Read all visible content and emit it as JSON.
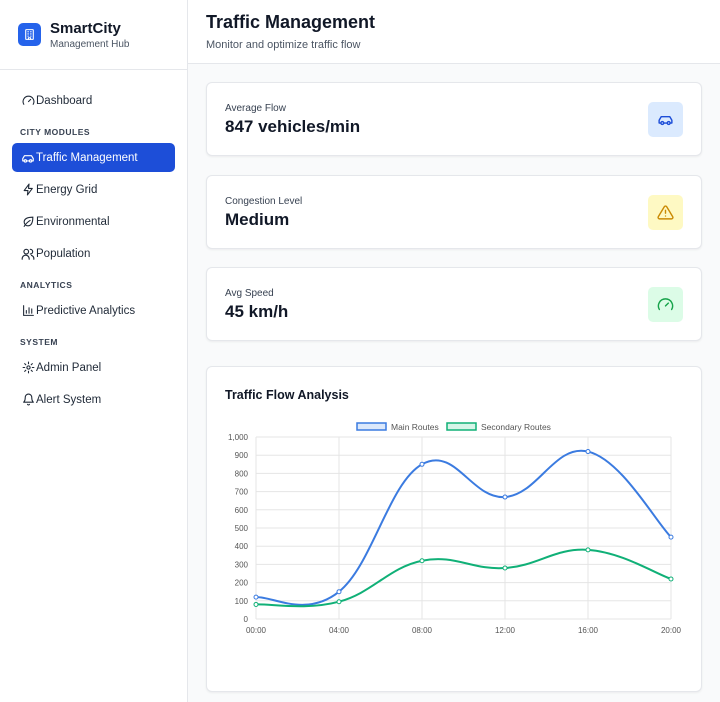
{
  "brand": {
    "name": "SmartCity",
    "subtitle": "Management Hub"
  },
  "sidebar": {
    "dashboard": "Dashboard",
    "sections": {
      "city_modules": "CITY MODULES",
      "analytics": "ANALYTICS",
      "system": "SYSTEM"
    },
    "items": {
      "traffic": "Traffic Management",
      "energy": "Energy Grid",
      "environmental": "Environmental",
      "population": "Population",
      "predictive": "Predictive Analytics",
      "admin": "Admin Panel",
      "alert": "Alert System"
    }
  },
  "header": {
    "title": "Traffic Management",
    "subtitle": "Monitor and optimize traffic flow"
  },
  "stats": [
    {
      "label": "Average Flow",
      "value": "847 vehicles/min",
      "icon": "car-icon",
      "icon_bg": "#dbeafe",
      "icon_color": "#1d4ed8"
    },
    {
      "label": "Congestion Level",
      "value": "Medium",
      "icon": "warning-icon",
      "icon_bg": "#fef9c3",
      "icon_color": "#ca8a04"
    },
    {
      "label": "Avg Speed",
      "value": "45 km/h",
      "icon": "speedometer-icon",
      "icon_bg": "#dcfce7",
      "icon_color": "#16a34a"
    }
  ],
  "chart_title": "Traffic Flow Analysis",
  "chart_data": {
    "type": "line",
    "categories": [
      "00:00",
      "04:00",
      "08:00",
      "12:00",
      "16:00",
      "20:00"
    ],
    "series": [
      {
        "name": "Main Routes",
        "values": [
          120,
          150,
          850,
          670,
          920,
          450
        ],
        "color": "#3b7be0"
      },
      {
        "name": "Secondary Routes",
        "values": [
          80,
          95,
          320,
          280,
          380,
          220
        ],
        "color": "#10b077"
      }
    ],
    "ylim": [
      0,
      1000
    ],
    "yticks": [
      "0",
      "100",
      "200",
      "300",
      "400",
      "500",
      "600",
      "700",
      "800",
      "900",
      "1,000"
    ],
    "grid": true,
    "legend": "top-center"
  }
}
